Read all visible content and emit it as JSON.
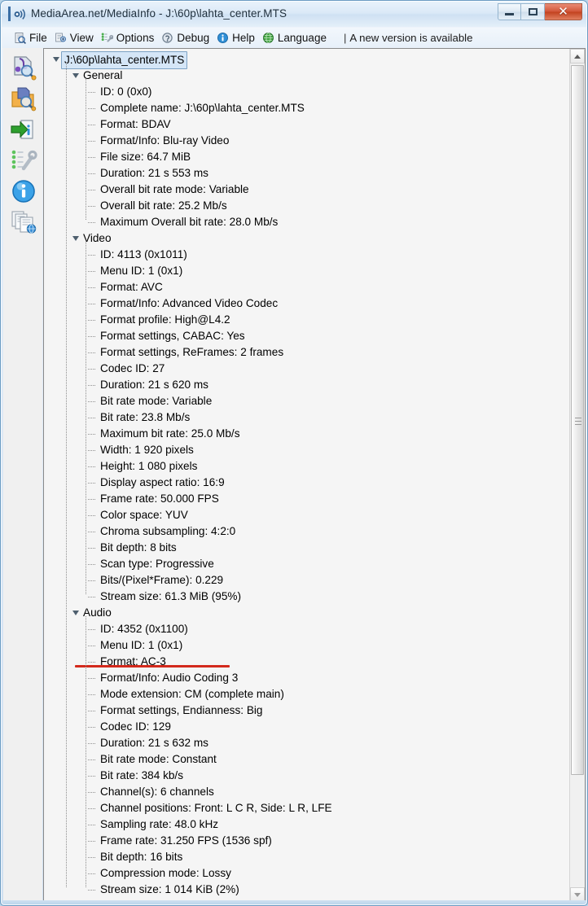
{
  "window": {
    "title": "MediaArea.net/MediaInfo - J:\\60p\\lahta_center.MTS",
    "app_icon": "mediainfo-icon",
    "controls": {
      "minimize": "Minimize",
      "maximize": "Maximize",
      "close": "Close"
    }
  },
  "menu": {
    "items": [
      {
        "label": "File",
        "icon": "file-icon"
      },
      {
        "label": "View",
        "icon": "view-icon"
      },
      {
        "label": "Options",
        "icon": "options-icon"
      },
      {
        "label": "Debug",
        "icon": "debug-icon"
      },
      {
        "label": "Help",
        "icon": "help-info-icon"
      },
      {
        "label": "Language",
        "icon": "globe-icon"
      }
    ],
    "separator": "|",
    "notice": "A new version is available"
  },
  "sidebar": {
    "items": [
      {
        "name": "open-file-icon",
        "tooltip": "Open file"
      },
      {
        "name": "open-folder-icon",
        "tooltip": "Open folder"
      },
      {
        "name": "export-info-icon",
        "tooltip": "Export"
      },
      {
        "name": "preferences-icon",
        "tooltip": "Preferences"
      },
      {
        "name": "about-info-icon",
        "tooltip": "About"
      },
      {
        "name": "reports-icon",
        "tooltip": "Reports"
      }
    ]
  },
  "tree": {
    "root": {
      "label": "J:\\60p\\lahta_center.MTS",
      "selected": true,
      "expanded": true
    },
    "sections": [
      {
        "label": "General",
        "expanded": true,
        "rows": [
          "ID: 0 (0x0)",
          "Complete name: J:\\60p\\lahta_center.MTS",
          "Format: BDAV",
          "Format/Info: Blu-ray Video",
          "File size: 64.7 MiB",
          "Duration: 21 s 553 ms",
          "Overall bit rate mode: Variable",
          "Overall bit rate: 25.2 Mb/s",
          "Maximum Overall bit rate: 28.0 Mb/s"
        ]
      },
      {
        "label": "Video",
        "expanded": true,
        "rows": [
          "ID: 4113 (0x1011)",
          "Menu ID: 1 (0x1)",
          "Format: AVC",
          "Format/Info: Advanced Video Codec",
          "Format profile: High@L4.2",
          "Format settings, CABAC: Yes",
          "Format settings, ReFrames: 2 frames",
          "Codec ID: 27",
          "Duration: 21 s 620 ms",
          "Bit rate mode: Variable",
          "Bit rate: 23.8 Mb/s",
          "Maximum bit rate: 25.0 Mb/s",
          "Width: 1 920 pixels",
          "Height: 1 080 pixels",
          "Display aspect ratio: 16:9",
          "Frame rate: 50.000 FPS",
          "Color space: YUV",
          "Chroma subsampling: 4:2:0",
          "Bit depth: 8 bits",
          "Scan type: Progressive",
          "Bits/(Pixel*Frame): 0.229",
          "Stream size: 61.3 MiB (95%)"
        ]
      },
      {
        "label": "Audio",
        "expanded": true,
        "rows": [
          "ID: 4352 (0x1100)",
          "Menu ID: 1 (0x1)",
          "Format: AC-3",
          "Format/Info: Audio Coding 3",
          "Mode extension: CM (complete main)",
          "Format settings, Endianness: Big",
          "Codec ID: 129",
          "Duration: 21 s 632 ms",
          "Bit rate mode: Constant",
          "Bit rate: 384 kb/s",
          "Channel(s): 6 channels",
          "Channel positions: Front: L C R, Side: L R, LFE",
          "Sampling rate: 48.0 kHz",
          "Frame rate: 31.250 FPS (1536 spf)",
          "Bit depth: 16 bits",
          "Compression mode: Lossy",
          "Stream size: 1 014 KiB (2%)"
        ]
      }
    ]
  },
  "annotation": {
    "name": "red-underline-annotation",
    "target_row": "Format: AC-3",
    "color": "#d3291c"
  },
  "scrollbar": {
    "up_arrow": "scroll-up-arrow",
    "down_arrow": "scroll-down-arrow",
    "thumb": "scroll-thumb"
  },
  "colors": {
    "accent": "#3a6ea5",
    "selection": "#d5e6f7",
    "annotation": "#d3291c",
    "panel_bg": "#f5f5f5"
  }
}
